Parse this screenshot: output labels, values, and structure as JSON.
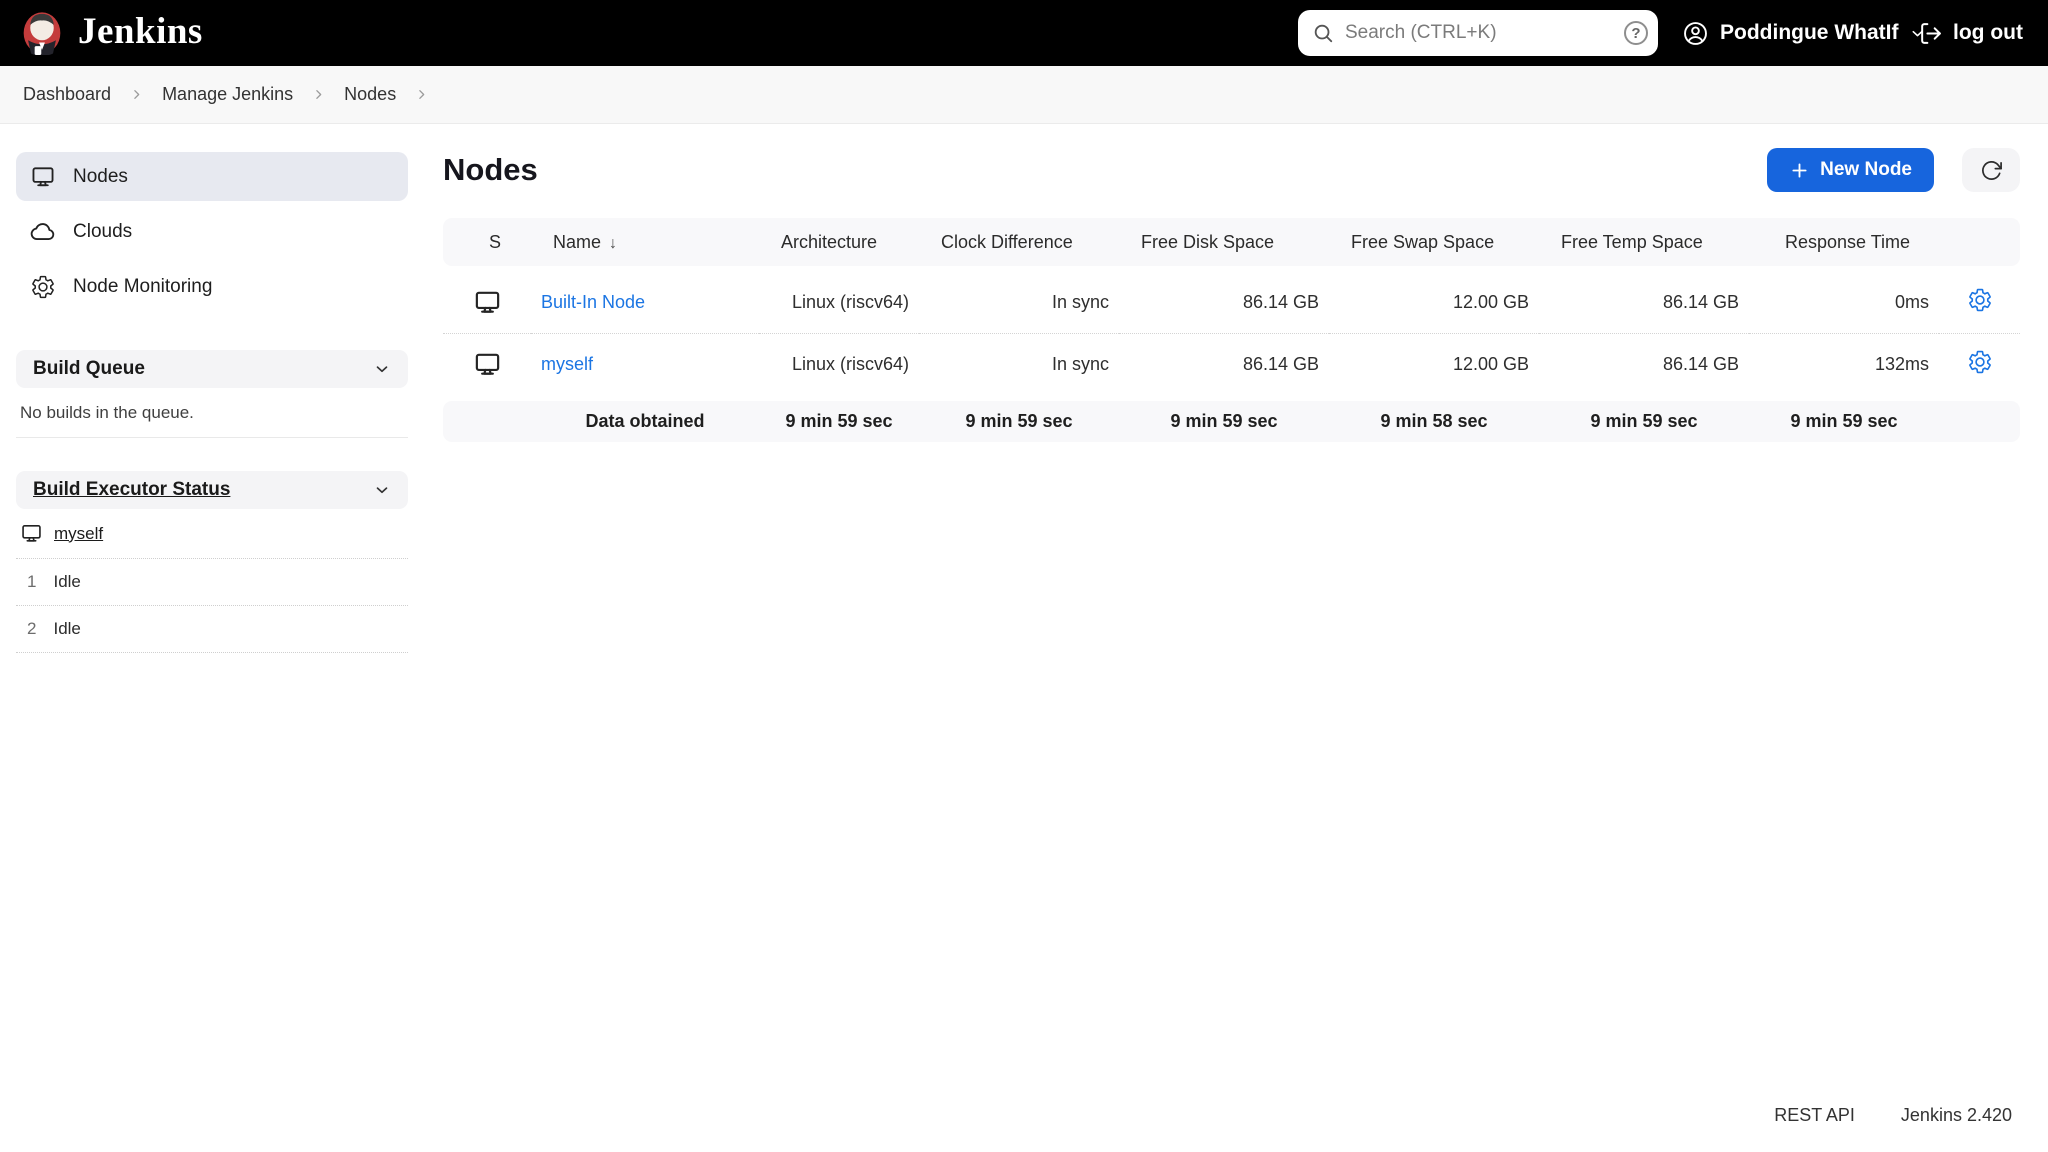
{
  "topbar": {
    "brand": "Jenkins",
    "search_placeholder": "Search (CTRL+K)",
    "help_symbol": "?",
    "user_name": "Poddingue WhatIf",
    "logout_label": "log out"
  },
  "breadcrumbs": {
    "items": [
      "Dashboard",
      "Manage Jenkins",
      "Nodes"
    ]
  },
  "sidebar": {
    "nav": [
      {
        "label": "Nodes",
        "icon": "monitor-icon",
        "active": true
      },
      {
        "label": "Clouds",
        "icon": "cloud-icon",
        "active": false
      },
      {
        "label": "Node Monitoring",
        "icon": "gear-icon",
        "active": false
      }
    ],
    "build_queue": {
      "title": "Build Queue",
      "empty_message": "No builds in the queue."
    },
    "executor_status": {
      "title": "Build Executor Status",
      "computer": "myself",
      "executors": [
        {
          "number": "1",
          "status": "Idle"
        },
        {
          "number": "2",
          "status": "Idle"
        }
      ]
    }
  },
  "main": {
    "title": "Nodes",
    "new_node_label": "New Node",
    "table": {
      "headers": [
        "S",
        "Name",
        "Architecture",
        "Clock Difference",
        "Free Disk Space",
        "Free Swap Space",
        "Free Temp Space",
        "Response Time"
      ],
      "sort_indicator": "↓",
      "rows": [
        {
          "name": "Built-In Node",
          "architecture": "Linux (riscv64)",
          "clock_difference": "In sync",
          "free_disk_space": "86.14 GB",
          "free_swap_space": "12.00 GB",
          "free_temp_space": "86.14 GB",
          "response_time": "0ms"
        },
        {
          "name": "myself",
          "architecture": "Linux (riscv64)",
          "clock_difference": "In sync",
          "free_disk_space": "86.14 GB",
          "free_swap_space": "12.00 GB",
          "free_temp_space": "86.14 GB",
          "response_time": "132ms"
        }
      ],
      "footer": {
        "label": "Data obtained",
        "architecture": "9 min 59 sec",
        "clock_difference": "9 min 59 sec",
        "free_disk_space": "9 min 59 sec",
        "free_swap_space": "9 min 58 sec",
        "free_temp_space": "9 min 59 sec",
        "response_time": "9 min 59 sec"
      }
    }
  },
  "footer": {
    "rest_api": "REST API",
    "version": "Jenkins 2.420"
  },
  "colors": {
    "topbar_bg": "#000000",
    "accent_blue": "#1b75e3",
    "button_blue": "#1765dd",
    "selected_item_bg": "#e7e9f0",
    "section_band_bg": "#f4f4f6",
    "table_band_bg": "#f8f8fa"
  }
}
